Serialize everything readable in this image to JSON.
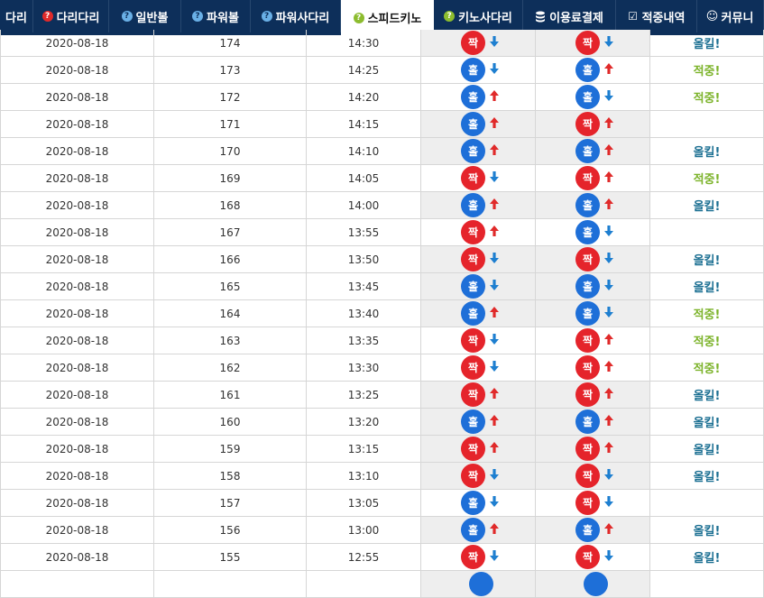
{
  "nav": {
    "tabs": [
      {
        "label": "다리",
        "icon": "",
        "active": false
      },
      {
        "label": "다리다리",
        "icon": "question-red",
        "active": false
      },
      {
        "label": "일반볼",
        "icon": "question-blue",
        "active": false
      },
      {
        "label": "파워볼",
        "icon": "question-blue",
        "active": false
      },
      {
        "label": "파워사다리",
        "icon": "question-blue",
        "active": false
      },
      {
        "label": "스피드키노",
        "icon": "question-green",
        "active": true
      },
      {
        "label": "키노사다리",
        "icon": "question-green",
        "active": false
      },
      {
        "label": "이용료결제",
        "icon": "database",
        "active": false
      },
      {
        "label": "적중내역",
        "icon": "checkbox",
        "active": false
      },
      {
        "label": "커뮤니",
        "icon": "smile",
        "active": false
      }
    ]
  },
  "colors": {
    "odd": "#1e6fd8",
    "even": "#e5242b",
    "up_arrow": "#e02a2a",
    "down_arrow": "#1e7fd0",
    "allkill": "#1b6f92",
    "hit": "#7cb32a"
  },
  "rows": [
    {
      "date": "2020-08-18",
      "round": "174",
      "time": "14:30",
      "r1": "짝",
      "r1_dir": "down",
      "r2": "짝",
      "r2_dir": "down",
      "result": "올킬!"
    },
    {
      "date": "2020-08-18",
      "round": "173",
      "time": "14:25",
      "r1": "홀",
      "r1_dir": "down",
      "r2": "홀",
      "r2_dir": "up",
      "result": "적중!"
    },
    {
      "date": "2020-08-18",
      "round": "172",
      "time": "14:20",
      "r1": "홀",
      "r1_dir": "up",
      "r2": "홀",
      "r2_dir": "down",
      "result": "적중!"
    },
    {
      "date": "2020-08-18",
      "round": "171",
      "time": "14:15",
      "r1": "홀",
      "r1_dir": "up",
      "r2": "짝",
      "r2_dir": "up",
      "result": ""
    },
    {
      "date": "2020-08-18",
      "round": "170",
      "time": "14:10",
      "r1": "홀",
      "r1_dir": "up",
      "r2": "홀",
      "r2_dir": "up",
      "result": "올킬!"
    },
    {
      "date": "2020-08-18",
      "round": "169",
      "time": "14:05",
      "r1": "짝",
      "r1_dir": "down",
      "r2": "짝",
      "r2_dir": "up",
      "result": "적중!"
    },
    {
      "date": "2020-08-18",
      "round": "168",
      "time": "14:00",
      "r1": "홀",
      "r1_dir": "up",
      "r2": "홀",
      "r2_dir": "up",
      "result": "올킬!"
    },
    {
      "date": "2020-08-18",
      "round": "167",
      "time": "13:55",
      "r1": "짝",
      "r1_dir": "up",
      "r2": "홀",
      "r2_dir": "down",
      "result": ""
    },
    {
      "date": "2020-08-18",
      "round": "166",
      "time": "13:50",
      "r1": "짝",
      "r1_dir": "down",
      "r2": "짝",
      "r2_dir": "down",
      "result": "올킬!"
    },
    {
      "date": "2020-08-18",
      "round": "165",
      "time": "13:45",
      "r1": "홀",
      "r1_dir": "down",
      "r2": "홀",
      "r2_dir": "down",
      "result": "올킬!"
    },
    {
      "date": "2020-08-18",
      "round": "164",
      "time": "13:40",
      "r1": "홀",
      "r1_dir": "up",
      "r2": "홀",
      "r2_dir": "down",
      "result": "적중!"
    },
    {
      "date": "2020-08-18",
      "round": "163",
      "time": "13:35",
      "r1": "짝",
      "r1_dir": "down",
      "r2": "짝",
      "r2_dir": "up",
      "result": "적중!"
    },
    {
      "date": "2020-08-18",
      "round": "162",
      "time": "13:30",
      "r1": "짝",
      "r1_dir": "down",
      "r2": "짝",
      "r2_dir": "up",
      "result": "적중!"
    },
    {
      "date": "2020-08-18",
      "round": "161",
      "time": "13:25",
      "r1": "짝",
      "r1_dir": "up",
      "r2": "짝",
      "r2_dir": "up",
      "result": "올킬!"
    },
    {
      "date": "2020-08-18",
      "round": "160",
      "time": "13:20",
      "r1": "홀",
      "r1_dir": "up",
      "r2": "홀",
      "r2_dir": "up",
      "result": "올킬!"
    },
    {
      "date": "2020-08-18",
      "round": "159",
      "time": "13:15",
      "r1": "짝",
      "r1_dir": "up",
      "r2": "짝",
      "r2_dir": "up",
      "result": "올킬!"
    },
    {
      "date": "2020-08-18",
      "round": "158",
      "time": "13:10",
      "r1": "짝",
      "r1_dir": "down",
      "r2": "짝",
      "r2_dir": "down",
      "result": "올킬!"
    },
    {
      "date": "2020-08-18",
      "round": "157",
      "time": "13:05",
      "r1": "홀",
      "r1_dir": "down",
      "r2": "짝",
      "r2_dir": "down",
      "result": ""
    },
    {
      "date": "2020-08-18",
      "round": "156",
      "time": "13:00",
      "r1": "홀",
      "r1_dir": "up",
      "r2": "홀",
      "r2_dir": "up",
      "result": "올킬!"
    },
    {
      "date": "2020-08-18",
      "round": "155",
      "time": "12:55",
      "r1": "짝",
      "r1_dir": "down",
      "r2": "짝",
      "r2_dir": "down",
      "result": "올킬!"
    }
  ]
}
